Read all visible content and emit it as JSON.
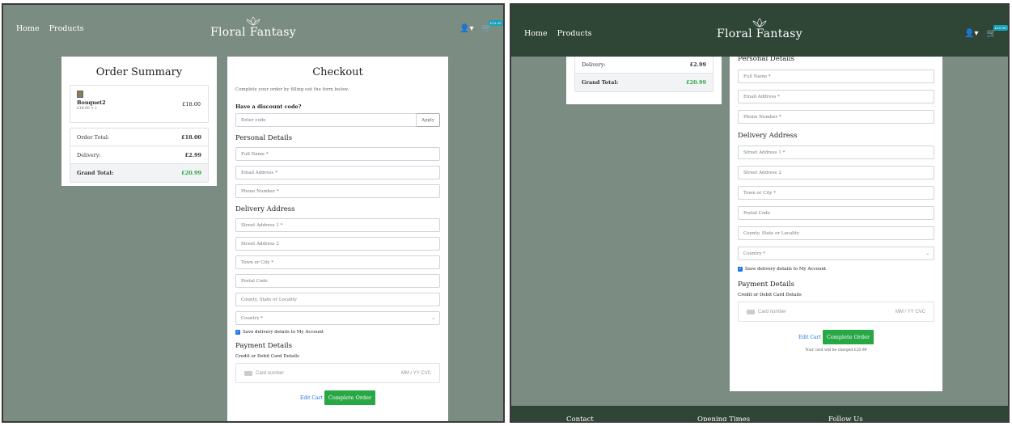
{
  "nav": {
    "links": [
      "Home",
      "Products"
    ],
    "brand": "Floral Fantasy",
    "cart_badge": "£20.99"
  },
  "summary": {
    "title": "Order Summary",
    "item": {
      "name": "Bouquet2",
      "qty": "£18.00 × 1",
      "price": "£18.00"
    },
    "rows": [
      {
        "label": "Order Total:",
        "value": "£18.00"
      },
      {
        "label": "Delivery:",
        "value": "£2.99"
      },
      {
        "label": "Grand Total:",
        "value": "£20.99"
      }
    ]
  },
  "checkout": {
    "title": "Checkout",
    "subtitle": "Complete your order by filling out the form below.",
    "discount_label": "Have a discount code?",
    "discount_placeholder": "Enter code",
    "apply_label": "Apply",
    "personal_heading": "Personal Details",
    "personal_fields": [
      "Full Name *",
      "Email Address *",
      "Phone Number *"
    ],
    "personal_heading_partial": "Personal Details",
    "delivery_heading": "Delivery Address",
    "delivery_fields": [
      "Street Address 1 *",
      "Street Address 2",
      "Town or City *",
      "Postal Code",
      "County, State or Locality"
    ],
    "country_placeholder": "Country *",
    "save_label": "Save delivery details to My Account",
    "payment_heading": "Payment Details",
    "card_label": "Credit or Debit Card Details",
    "card_number_placeholder": "Card number",
    "card_expiry_placeholder": "MM / YY  CVC",
    "edit_cart_label": "Edit Cart",
    "complete_label": "Complete Order",
    "charge_note": "Your card will be charged £20.99"
  },
  "footer": {
    "headings": [
      "Contact",
      "Opening Times",
      "Follow Us"
    ]
  }
}
